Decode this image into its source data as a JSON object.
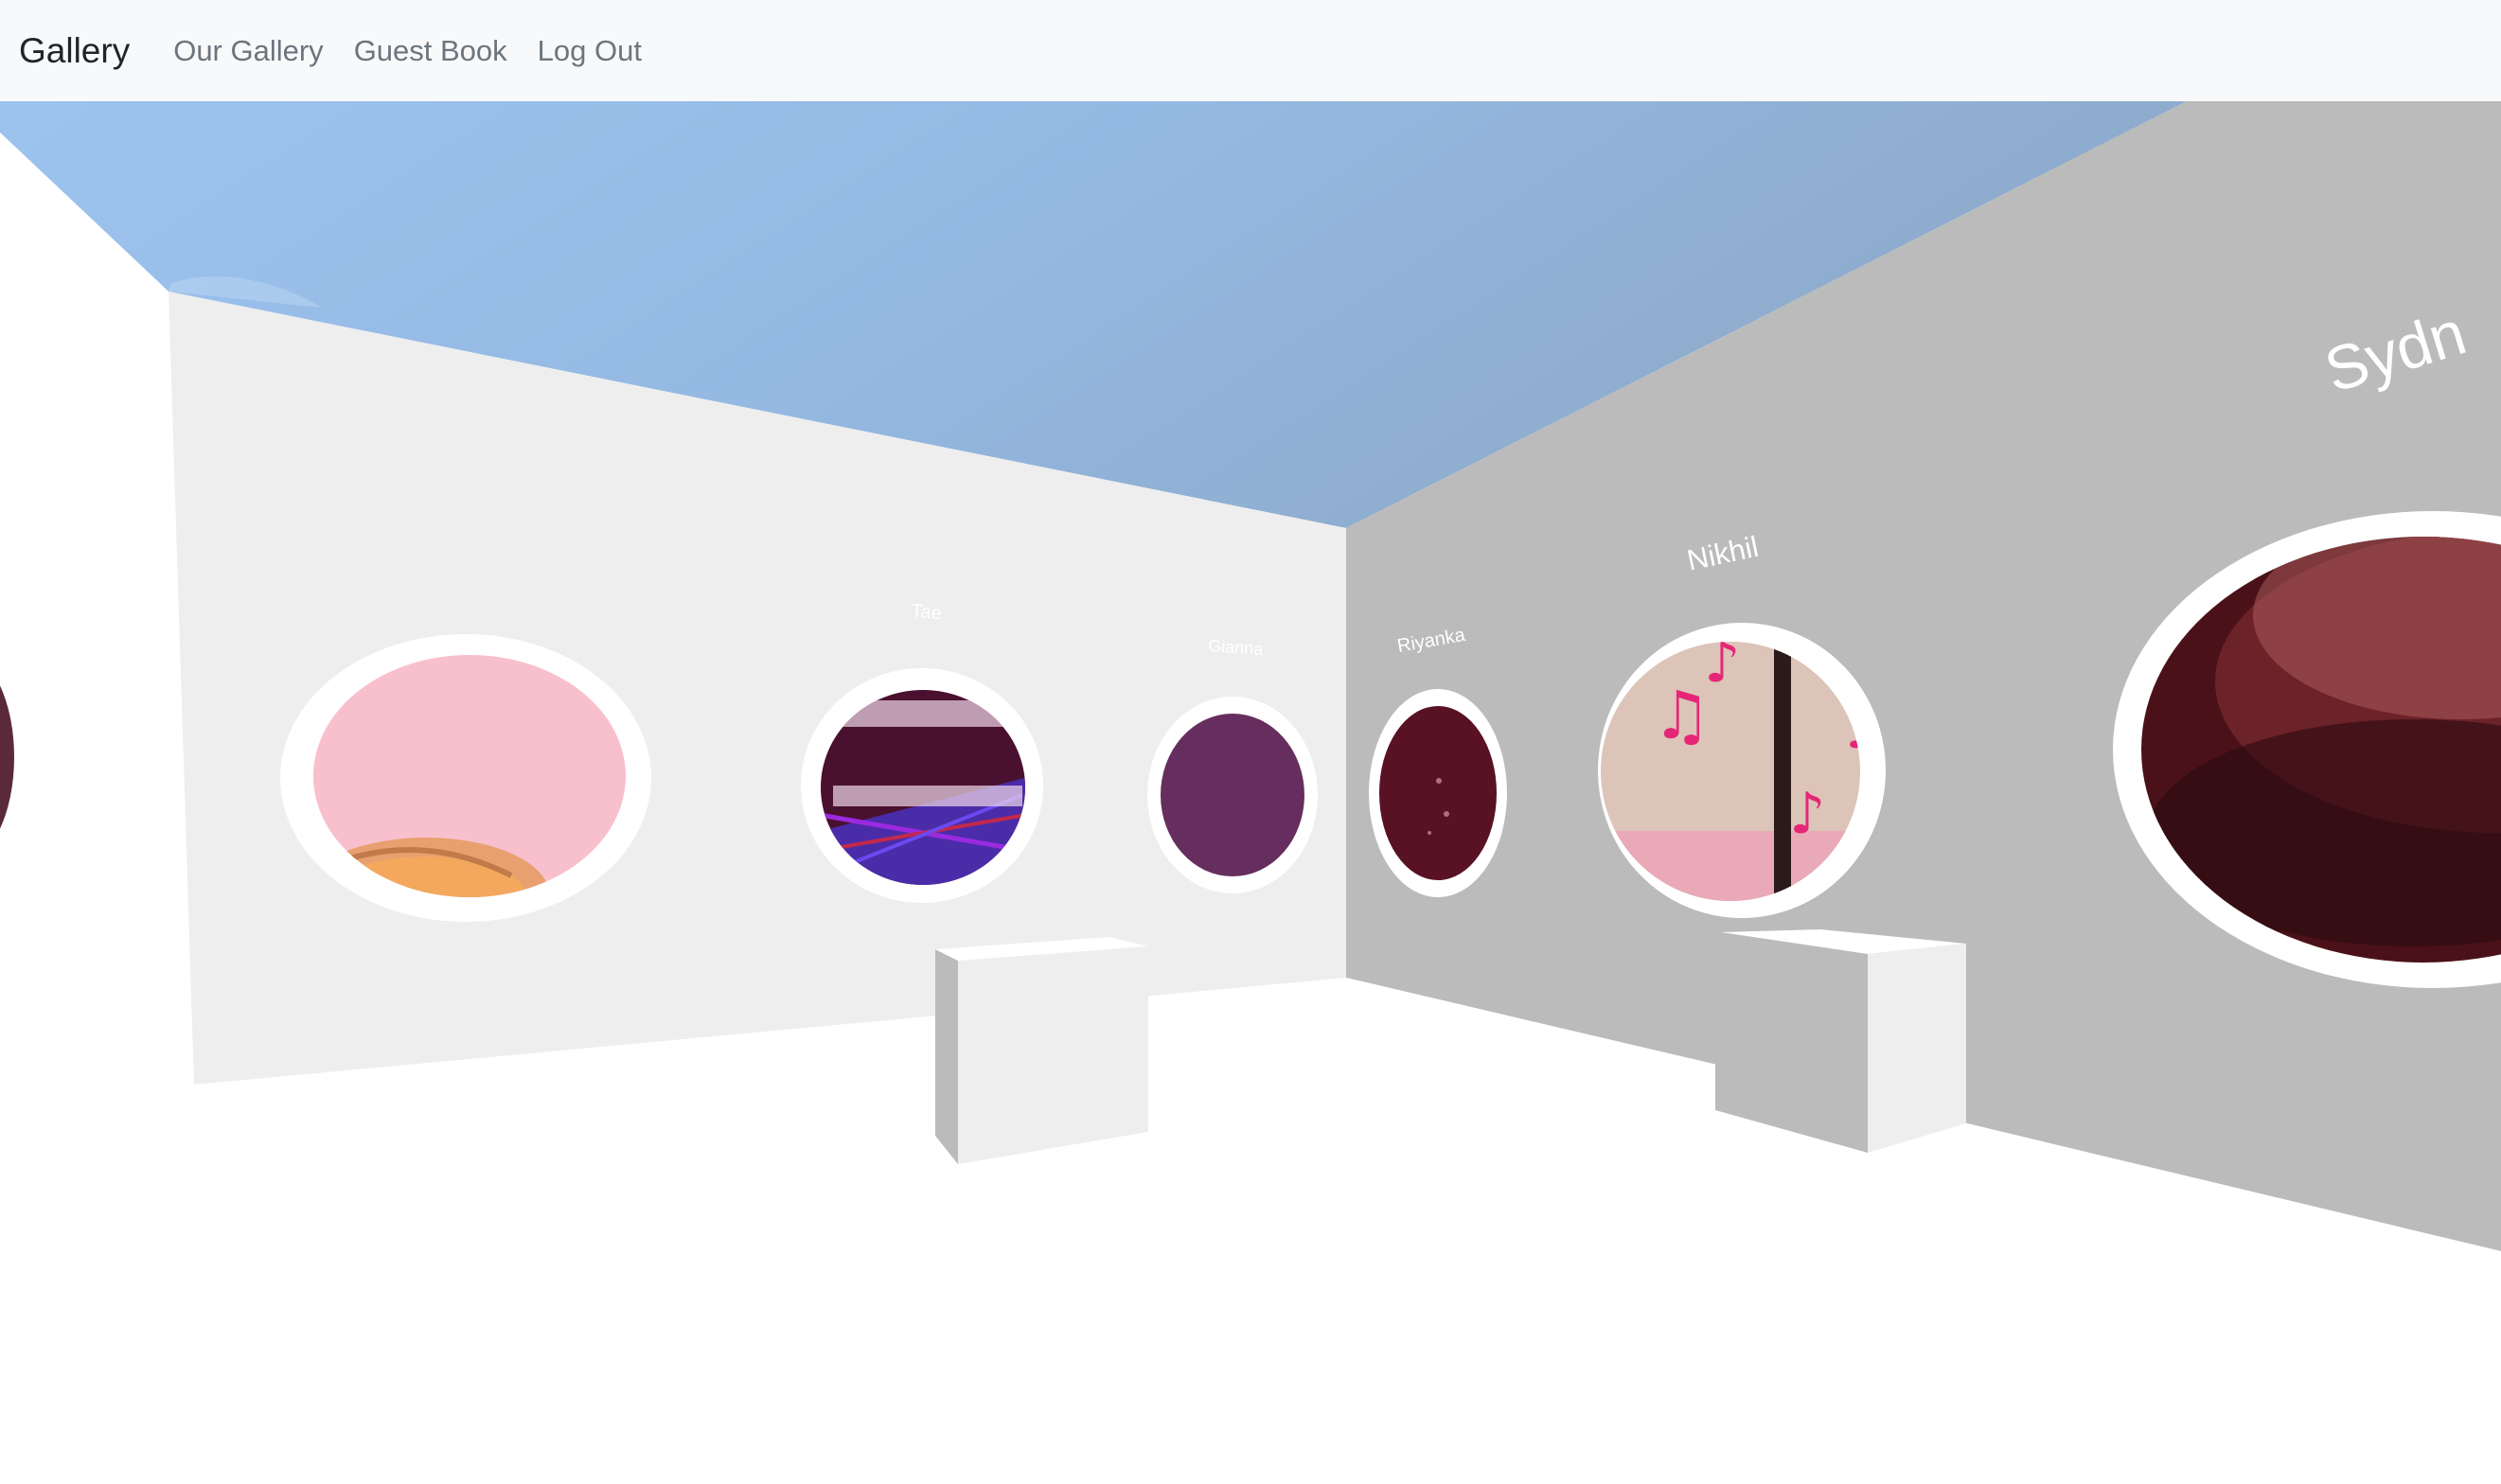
{
  "navbar": {
    "brand": "Gallery",
    "links": [
      "Our Gallery",
      "Guest Book",
      "Log Out"
    ]
  },
  "gallery": {
    "artist_labels": [
      "Tae",
      "Gianna",
      "Riyanka",
      "Nikhil",
      "Sydn"
    ]
  },
  "colors": {
    "sky": "#8fb6e0",
    "left_wall": "#eeeeee",
    "right_wall": "#bbbbbb",
    "floor": "#ffffff",
    "navbar_bg": "#f8f9fa"
  }
}
